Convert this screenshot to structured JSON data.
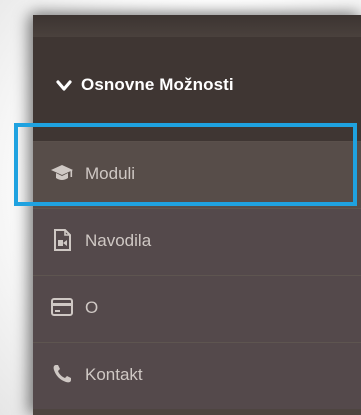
{
  "menu": {
    "header_label": "Osnovne Možnosti",
    "header_icon": "chevron-down-icon",
    "items": [
      {
        "label": "Moduli",
        "icon": "graduation-cap-icon",
        "selected": true
      },
      {
        "label": "Navodila",
        "icon": "document-icon"
      },
      {
        "label": "O",
        "icon": "card-icon"
      },
      {
        "label": "Kontakt",
        "icon": "phone-icon"
      }
    ]
  },
  "colors": {
    "panel": "#4e4541",
    "header": "#3f3633",
    "text": "#cfc8c4",
    "selection": "#1fa2e0"
  }
}
